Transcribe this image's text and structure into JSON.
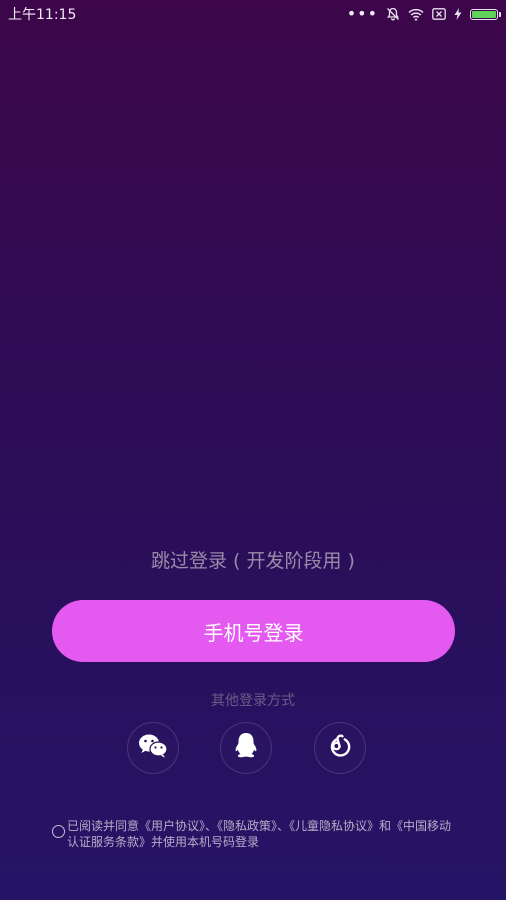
{
  "status_bar": {
    "time": "上午11:15"
  },
  "login": {
    "skip_label": "跳过登录 ( 开发阶段用 )",
    "phone_login_label": "手机号登录",
    "other_methods_label": "其他登录方式",
    "social": [
      {
        "name": "wechat-icon"
      },
      {
        "name": "qq-icon"
      },
      {
        "name": "netease-music-icon"
      }
    ],
    "agreement_text": "已阅读并同意《用户协议》、《隐私政策》、《儿童隐私协议》和《中国移动认证服务条款》并使用本机号码登录"
  },
  "colors": {
    "background_top": "#3d064a",
    "background_bottom": "#251466",
    "accent": "#e459f0",
    "battery": "#5fd35a"
  }
}
